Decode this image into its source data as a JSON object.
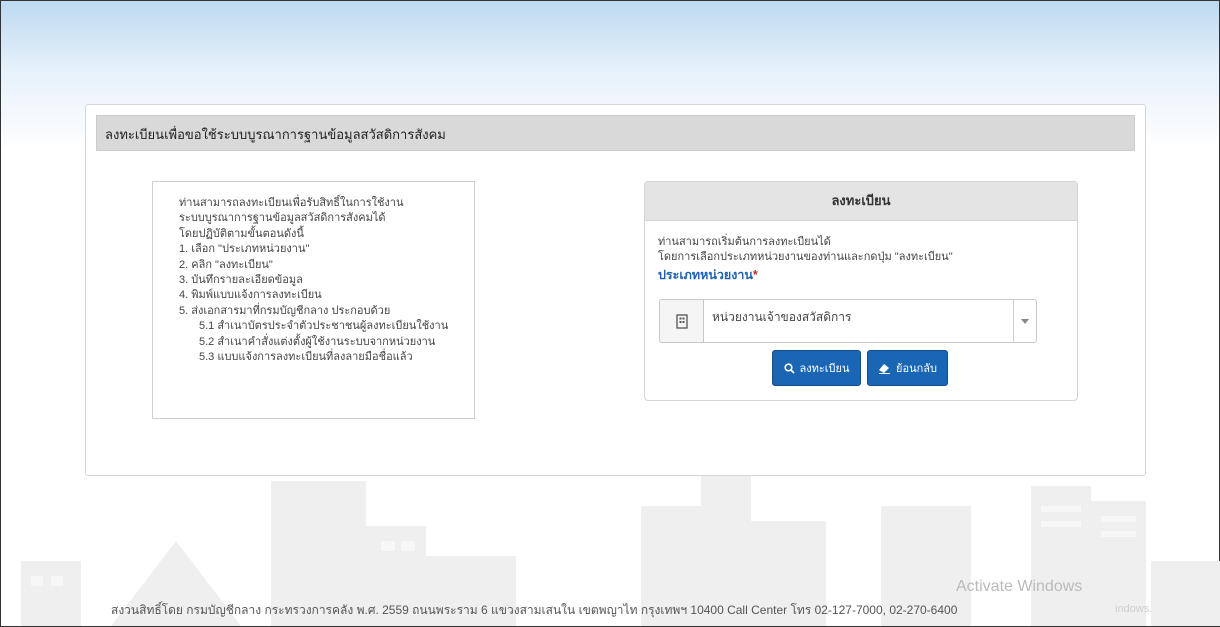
{
  "header": {
    "title": "ลงทะเบียนเพื่อขอใช้ระบบบูรณาการฐานข้อมูลสวัสดิการสังคม"
  },
  "instructions": {
    "lines": [
      "ท่านสามารถลงทะเบียนเพื่อรับสิทธิ์ในการใช้งาน",
      "ระบบบูรณาการฐานข้อมูลสวัสดิการสังคมได้",
      "โดยปฏิบัติตามขั้นตอนดังนี้",
      "1. เลือก \"ประเภทหน่วยงาน\"",
      "2. คลิก \"ลงทะเบียน\"",
      "3. บันทึกรายละเอียดข้อมูล",
      "4. พิมพ์แบบแจ้งการลงทะเบียน",
      "5. ส่งเอกสารมาที่กรมบัญชีกลาง ประกอบด้วย"
    ],
    "sub_lines": [
      "5.1 สำเนาบัตรประจำตัวประชาชนผู้ลงทะเบียนใช้งาน",
      "5.2 สำเนาคำสั่งแต่งตั้งผู้ใช้งานระบบจากหน่วยงาน",
      "5.3 แบบแจ้งการลงทะเบียนที่ลงลายมือชื่อแล้ว"
    ]
  },
  "register_panel": {
    "title": "ลงทะเบียน",
    "description_1": "ท่านสามารถเริ่มต้นการลงทะเบียนได้",
    "description_2": "โดยการเลือกประเภทหน่วยงานของท่านและกดปุ่ม \"ลงทะเบียน\"",
    "type_label": "ประเภทหน่วยงาน",
    "required_mark": "*",
    "selected_type": "หน่วยงานเจ้าของสวัสดิการ",
    "register_button": "ลงทะเบียน",
    "back_button": "ย้อนกลับ"
  },
  "footer": {
    "text": "สงวนสิทธิ์โดย กรมบัญชีกลาง กระทรวงการคลัง พ.ศ. 2559 ถนนพระราม 6 แขวงสามเสนใน เขตพญาไท กรุงเทพฯ 10400 Call Center โทร 02-127-7000, 02-270-6400"
  },
  "watermark": {
    "line1": "Activate Windows",
    "line2": "indows."
  },
  "colors": {
    "primary": "#1b66b4",
    "label_blue": "#1f63b0",
    "required_red": "#d9262c",
    "header_gray": "#d9d9d9"
  },
  "icons": {
    "select_addon": "building-icon",
    "register": "search-icon",
    "back": "eraser-icon"
  }
}
